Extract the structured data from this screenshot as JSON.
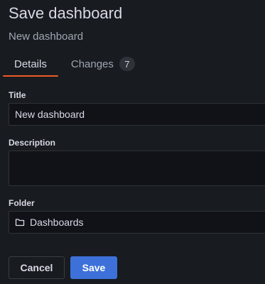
{
  "header": {
    "title": "Save dashboard",
    "subtitle": "New dashboard"
  },
  "tabs": [
    {
      "label": "Details",
      "active": true
    },
    {
      "label": "Changes",
      "count": "7",
      "active": false
    }
  ],
  "form": {
    "title": {
      "label": "Title",
      "value": "New dashboard"
    },
    "description": {
      "label": "Description",
      "value": ""
    },
    "folder": {
      "label": "Folder",
      "value": "Dashboards",
      "icon": "folder-icon"
    }
  },
  "actions": {
    "cancel_label": "Cancel",
    "save_label": "Save"
  },
  "colors": {
    "background": "#181b1f",
    "active_tab_indicator": "#f05a28",
    "primary_button": "#3d71d9"
  }
}
